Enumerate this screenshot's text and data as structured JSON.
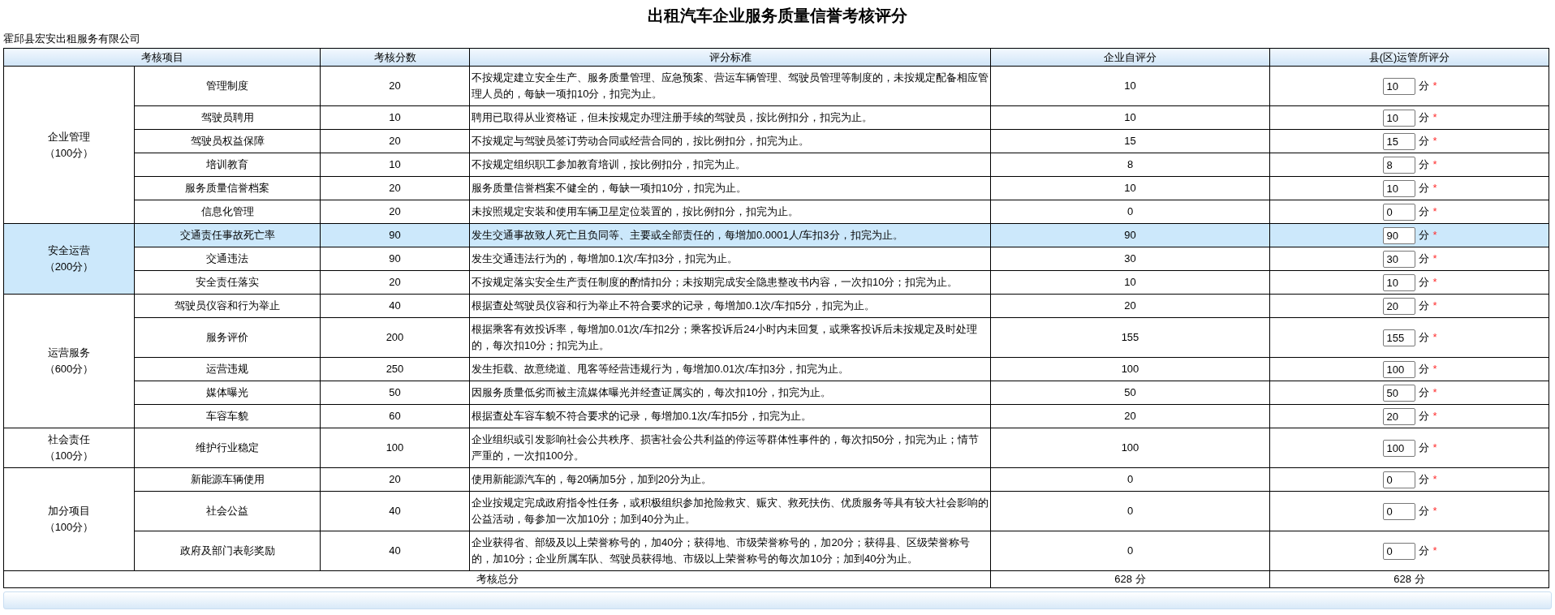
{
  "title": "出租汽车企业服务质量信誉考核评分",
  "company": "霍邱县宏安出租服务有限公司",
  "columns": [
    "考核项目",
    "考核分数",
    "评分标准",
    "企业自评分",
    "县(区)运管所评分"
  ],
  "groups": [
    {
      "name": "企业管理",
      "points": "（100分）",
      "rows": [
        {
          "item": "管理制度",
          "score": "20",
          "criteria": "不按规定建立安全生产、服务质量管理、应急预案、营运车辆管理、驾驶员管理等制度的，未按规定配备相应管理人员的，每缺一项扣10分，扣完为止。",
          "self_score": "10",
          "county_score": "10",
          "unit": "分",
          "required": "*",
          "selected": false
        },
        {
          "item": "驾驶员聘用",
          "score": "10",
          "criteria": "聘用已取得从业资格证，但未按规定办理注册手续的驾驶员，按比例扣分，扣完为止。",
          "self_score": "10",
          "county_score": "10",
          "unit": "分",
          "required": "*",
          "selected": false
        },
        {
          "item": "驾驶员权益保障",
          "score": "20",
          "criteria": "不按规定与驾驶员签订劳动合同或经营合同的，按比例扣分，扣完为止。",
          "self_score": "15",
          "county_score": "15",
          "unit": "分",
          "required": "*",
          "selected": false
        },
        {
          "item": "培训教育",
          "score": "10",
          "criteria": "不按规定组织职工参加教育培训，按比例扣分，扣完为止。",
          "self_score": "8",
          "county_score": "8",
          "unit": "分",
          "required": "*",
          "selected": false
        },
        {
          "item": "服务质量信誉档案",
          "score": "20",
          "criteria": "服务质量信誉档案不健全的，每缺一项扣10分，扣完为止。",
          "self_score": "10",
          "county_score": "10",
          "unit": "分",
          "required": "*",
          "selected": false
        },
        {
          "item": "信息化管理",
          "score": "20",
          "criteria": "未按照规定安装和使用车辆卫星定位装置的，按比例扣分，扣完为止。",
          "self_score": "0",
          "county_score": "0",
          "unit": "分",
          "required": "*",
          "selected": false
        }
      ]
    },
    {
      "name": "安全运营",
      "points": "（200分）",
      "rows": [
        {
          "item": "交通责任事故死亡率",
          "score": "90",
          "criteria": "发生交通事故致人死亡且负同等、主要或全部责任的，每增加0.0001人/车扣3分，扣完为止。",
          "self_score": "90",
          "county_score": "90",
          "unit": "分",
          "required": "*",
          "selected": true
        },
        {
          "item": "交通违法",
          "score": "90",
          "criteria": "发生交通违法行为的，每增加0.1次/车扣3分，扣完为止。",
          "self_score": "30",
          "county_score": "30",
          "unit": "分",
          "required": "*",
          "selected": false
        },
        {
          "item": "安全责任落实",
          "score": "20",
          "criteria": "不按规定落实安全生产责任制度的酌情扣分；未按期完成安全隐患整改书内容，一次扣10分；扣完为止。",
          "self_score": "10",
          "county_score": "10",
          "unit": "分",
          "required": "*",
          "selected": false
        }
      ]
    },
    {
      "name": "运营服务",
      "points": "（600分）",
      "rows": [
        {
          "item": "驾驶员仪容和行为举止",
          "score": "40",
          "criteria": "根据查处驾驶员仪容和行为举止不符合要求的记录，每增加0.1次/车扣5分，扣完为止。",
          "self_score": "20",
          "county_score": "20",
          "unit": "分",
          "required": "*",
          "selected": false
        },
        {
          "item": "服务评价",
          "score": "200",
          "criteria": "根据乘客有效投诉率，每增加0.01次/车扣2分；乘客投诉后24小时内未回复，或乘客投诉后未按规定及时处理的，每次扣10分；扣完为止。",
          "self_score": "155",
          "county_score": "155",
          "unit": "分",
          "required": "*",
          "selected": false
        },
        {
          "item": "运营违规",
          "score": "250",
          "criteria": "发生拒载、故意绕道、甩客等经营违规行为，每增加0.01次/车扣3分，扣完为止。",
          "self_score": "100",
          "county_score": "100",
          "unit": "分",
          "required": "*",
          "selected": false
        },
        {
          "item": "媒体曝光",
          "score": "50",
          "criteria": "因服务质量低劣而被主流媒体曝光并经查证属实的，每次扣10分，扣完为止。",
          "self_score": "50",
          "county_score": "50",
          "unit": "分",
          "required": "*",
          "selected": false
        },
        {
          "item": "车容车貌",
          "score": "60",
          "criteria": "根据查处车容车貌不符合要求的记录，每增加0.1次/车扣5分，扣完为止。",
          "self_score": "20",
          "county_score": "20",
          "unit": "分",
          "required": "*",
          "selected": false
        }
      ]
    },
    {
      "name": "社会责任",
      "points": "（100分）",
      "rows": [
        {
          "item": "维护行业稳定",
          "score": "100",
          "criteria": "企业组织或引发影响社会公共秩序、损害社会公共利益的停运等群体性事件的，每次扣50分，扣完为止；情节严重的，一次扣100分。",
          "self_score": "100",
          "county_score": "100",
          "unit": "分",
          "required": "*",
          "selected": false
        }
      ]
    },
    {
      "name": "加分项目",
      "points": "（100分）",
      "rows": [
        {
          "item": "新能源车辆使用",
          "score": "20",
          "criteria": "使用新能源汽车的，每20辆加5分，加到20分为止。",
          "self_score": "0",
          "county_score": "0",
          "unit": "分",
          "required": "*",
          "selected": false
        },
        {
          "item": "社会公益",
          "score": "40",
          "criteria": "企业按规定完成政府指令性任务，或积极组织参加抢险救灾、赈灾、救死扶伤、优质服务等具有较大社会影响的公益活动，每参加一次加10分；加到40分为止。",
          "self_score": "0",
          "county_score": "0",
          "unit": "分",
          "required": "*",
          "selected": false
        },
        {
          "item": "政府及部门表彰奖励",
          "score": "40",
          "criteria": "企业获得省、部级及以上荣誉称号的，加40分；获得地、市级荣誉称号的，加20分；获得县、区级荣誉称号的，加10分；企业所属车队、驾驶员获得地、市级以上荣誉称号的每次加10分；加到40分为止。",
          "self_score": "0",
          "county_score": "0",
          "unit": "分",
          "required": "*",
          "selected": false
        }
      ]
    }
  ],
  "total": {
    "label": "考核总分",
    "self_total": "628 分",
    "county_total": "628 分"
  }
}
